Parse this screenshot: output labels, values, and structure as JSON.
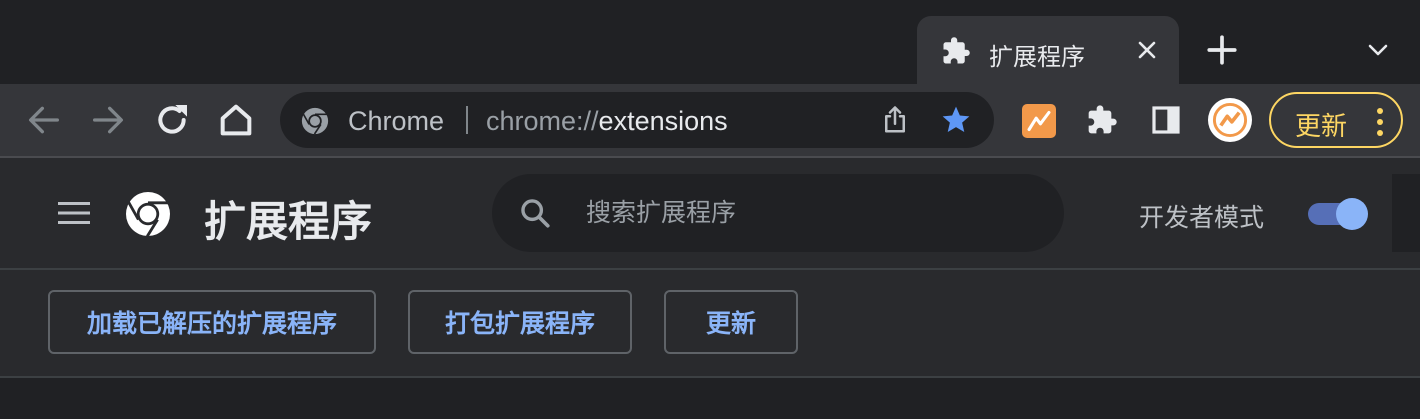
{
  "tab": {
    "title": "扩展程序",
    "icon": "puzzle-icon"
  },
  "toolbar": {
    "back_icon": "arrow-left-icon",
    "forward_icon": "arrow-right-icon",
    "reload_icon": "reload-icon",
    "home_icon": "home-icon",
    "site_chip": "Chrome",
    "url_scheme": "chrome://",
    "url_host": "extensions",
    "update_label": "更新"
  },
  "header": {
    "title": "扩展程序",
    "search_placeholder": "搜索扩展程序",
    "dev_mode_label": "开发者模式",
    "dev_mode_on": true
  },
  "actions": {
    "load_unpacked": "加载已解压的扩展程序",
    "pack": "打包扩展程序",
    "update": "更新"
  },
  "colors": {
    "accent": "#8ab4f8",
    "update_yellow": "#fdd663",
    "bookmark_star": "#5e97f6",
    "extension_orange": "#f2994a"
  }
}
